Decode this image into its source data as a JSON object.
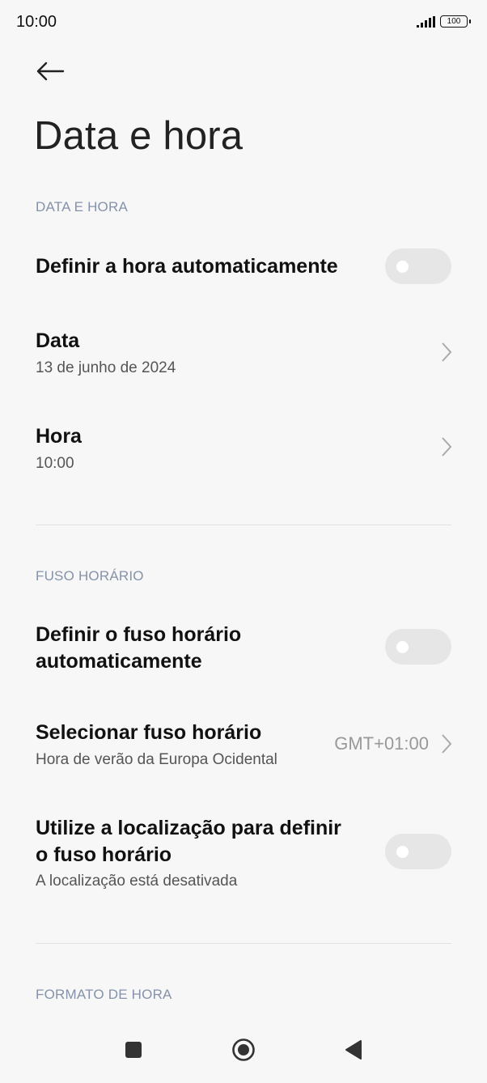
{
  "status_bar": {
    "time": "10:00",
    "battery": "100"
  },
  "header": {
    "title": "Data e hora"
  },
  "sections": {
    "date_time": {
      "header": "DATA E HORA",
      "auto_time": {
        "label": "Definir a hora automaticamente",
        "enabled": false
      },
      "date": {
        "label": "Data",
        "value": "13 de junho de 2024"
      },
      "time": {
        "label": "Hora",
        "value": "10:00"
      }
    },
    "timezone": {
      "header": "FUSO HORÁRIO",
      "auto_timezone": {
        "label_line1": "Definir o fuso horário",
        "label_line2": "automaticamente",
        "enabled": false
      },
      "select_timezone": {
        "label": "Selecionar fuso horário",
        "sub": "Hora de verão da Europa Ocidental",
        "value": "GMT+01:00"
      },
      "use_location": {
        "label_line1": "Utilize a localização para definir",
        "label_line2": "o fuso horário",
        "sub": "A localização está desativada",
        "enabled": false
      }
    },
    "time_format": {
      "header": "FORMATO DE HORA"
    }
  },
  "icons": {
    "back": "arrow-left-icon",
    "chevron": "chevron-right-icon",
    "nav_recents": "square-icon",
    "nav_home": "circle-icon",
    "nav_back": "triangle-left-icon"
  },
  "colors": {
    "background": "#f7f7f7",
    "section_header": "#8592a8",
    "toggle_off": "#e6e6e6"
  }
}
